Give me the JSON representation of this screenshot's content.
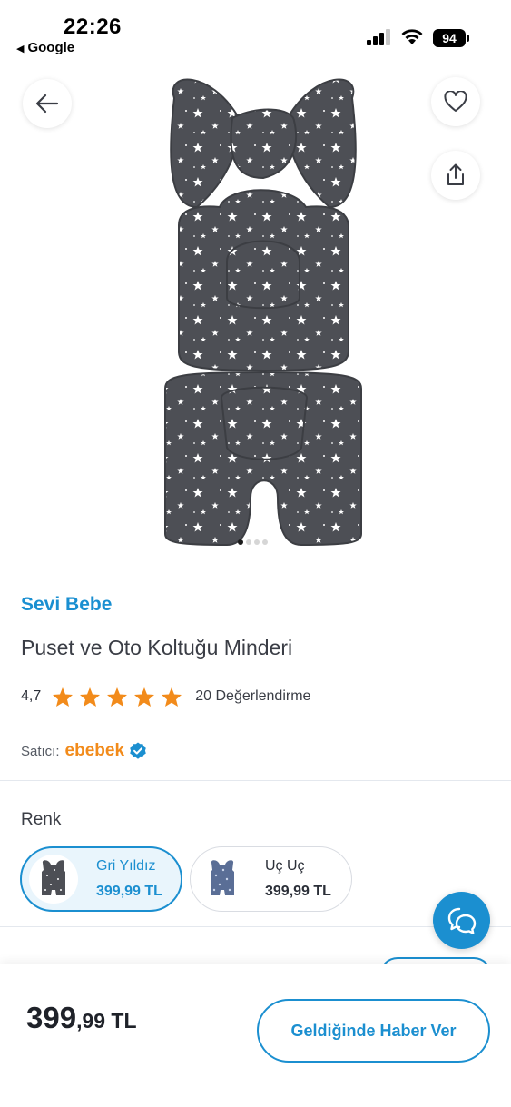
{
  "status_bar": {
    "time": "22:26",
    "back_app": "Google",
    "battery": "94"
  },
  "gallery": {
    "image_count": 4,
    "active_index": 0
  },
  "product": {
    "brand": "Sevi Bebe",
    "title": "Puset ve Oto Koltuğu Minderi",
    "rating": "4,7",
    "stars": 5,
    "review_count": "20 Değerlendirme",
    "seller_label": "Satıcı:",
    "seller_name": "ebebek"
  },
  "color_section": {
    "title": "Renk",
    "variants": [
      {
        "name": "Gri Yıldız",
        "price": "399,99 TL",
        "selected": true
      },
      {
        "name": "Uç Uç",
        "price": "399,99 TL",
        "selected": false
      }
    ]
  },
  "bottom_bar": {
    "price_int": "399",
    "price_dec": ",99 TL",
    "notify_label": "Geldiğinde Haber Ver"
  },
  "colors": {
    "accent": "#1b8fd0",
    "brand": "#1a8fd1",
    "seller": "#f28b1b",
    "star": "#f28b1b"
  },
  "icons": {
    "back": "arrow-left-icon",
    "favorite": "heart-icon",
    "share": "share-icon",
    "chat": "chat-bubbles-icon",
    "verified": "verified-badge-icon"
  }
}
